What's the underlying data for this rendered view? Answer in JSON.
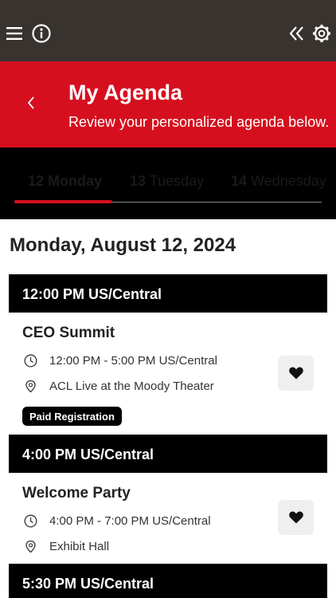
{
  "header": {
    "menu_icon": "hamburger-icon",
    "info_icon": "info-icon",
    "collapse_icon": "double-chevron-left-icon",
    "settings_icon": "gear-icon"
  },
  "hero": {
    "title": "My Agenda",
    "subtitle": "Review your personalized agenda below.",
    "back_icon": "chevron-left-icon",
    "color": "#d60f1f"
  },
  "days": [
    {
      "num": "12",
      "name": "Monday",
      "active": true
    },
    {
      "num": "13",
      "name": "Tuesday",
      "active": false
    },
    {
      "num": "14",
      "name": "Wednesday",
      "active": false
    }
  ],
  "date_heading": "Monday, August 12, 2024",
  "slots": [
    {
      "time_label": "12:00 PM US/Central",
      "event": {
        "title": "CEO Summit",
        "time": "12:00 PM - 5:00 PM US/Central",
        "location": "ACL Live at the Moody Theater",
        "badge": "Paid Registration"
      }
    },
    {
      "time_label": "4:00 PM US/Central",
      "event": {
        "title": "Welcome Party",
        "time": "4:00 PM - 7:00 PM US/Central",
        "location": "Exhibit Hall"
      }
    },
    {
      "time_label": "5:30 PM US/Central"
    }
  ]
}
